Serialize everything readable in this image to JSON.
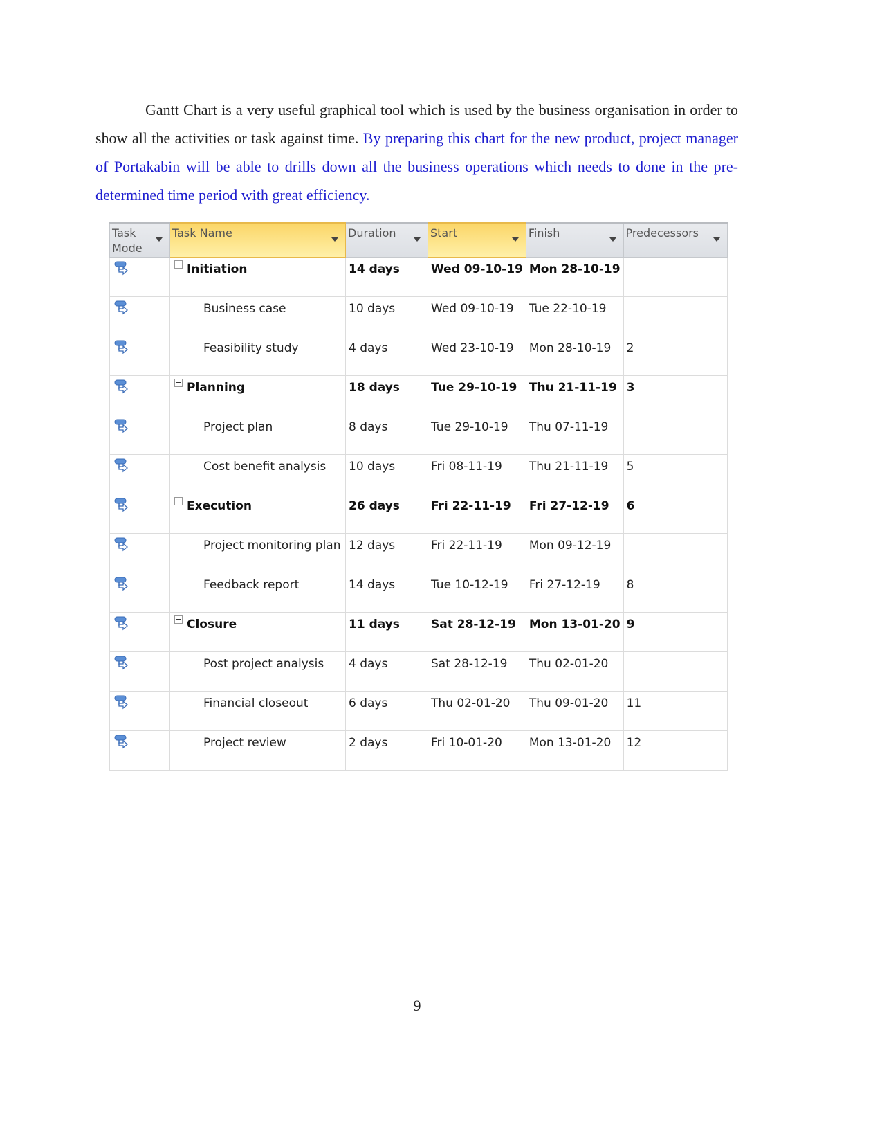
{
  "paragraph": {
    "plain": "Gantt Chart is a very useful graphical tool which is used by the business organisation in order to show all the activities or task against time.",
    "highlighted": "By preparing this chart for the new product, project manager of Portakabin will be able to drills down all the business operations which needs to done in the pre-determined time period with great efficiency.",
    "highlight_color": "#1f1fd0"
  },
  "table": {
    "headers": [
      "Task Mode",
      "Task Name",
      "Duration",
      "Start",
      "Finish",
      "Predecessors"
    ],
    "rows": [
      {
        "name": "Initiation",
        "duration": "14 days",
        "start": "Wed 09-10-19",
        "finish": "Mon 28-10-19",
        "pred": "",
        "summary": true
      },
      {
        "name": "Business case",
        "duration": "10 days",
        "start": "Wed 09-10-19",
        "finish": "Tue 22-10-19",
        "pred": "",
        "summary": false
      },
      {
        "name": "Feasibility study",
        "duration": "4 days",
        "start": "Wed 23-10-19",
        "finish": "Mon 28-10-19",
        "pred": "2",
        "summary": false
      },
      {
        "name": "Planning",
        "duration": "18 days",
        "start": "Tue 29-10-19",
        "finish": "Thu 21-11-19",
        "pred": "3",
        "summary": true
      },
      {
        "name": "Project plan",
        "duration": "8 days",
        "start": "Tue 29-10-19",
        "finish": "Thu 07-11-19",
        "pred": "",
        "summary": false
      },
      {
        "name": "Cost benefit analysis",
        "duration": "10 days",
        "start": "Fri 08-11-19",
        "finish": "Thu 21-11-19",
        "pred": "5",
        "summary": false
      },
      {
        "name": "Execution",
        "duration": "26 days",
        "start": "Fri 22-11-19",
        "finish": "Fri 27-12-19",
        "pred": "6",
        "summary": true
      },
      {
        "name": "Project monitoring plan",
        "duration": "12 days",
        "start": "Fri 22-11-19",
        "finish": "Mon 09-12-19",
        "pred": "",
        "summary": false
      },
      {
        "name": "Feedback report",
        "duration": "14 days",
        "start": "Tue 10-12-19",
        "finish": "Fri 27-12-19",
        "pred": "8",
        "summary": false
      },
      {
        "name": "Closure",
        "duration": "11 days",
        "start": "Sat 28-12-19",
        "finish": "Mon 13-01-20",
        "pred": "9",
        "summary": true
      },
      {
        "name": "Post project analysis",
        "duration": "4 days",
        "start": "Sat 28-12-19",
        "finish": "Thu 02-01-20",
        "pred": "",
        "summary": false
      },
      {
        "name": "Financial closeout",
        "duration": "6 days",
        "start": "Thu 02-01-20",
        "finish": "Thu 09-01-20",
        "pred": "11",
        "summary": false
      },
      {
        "name": "Project review",
        "duration": "2 days",
        "start": "Fri 10-01-20",
        "finish": "Mon 13-01-20",
        "pred": "12",
        "summary": false
      }
    ],
    "task_mode_icon": "auto-scheduled-task-icon",
    "header_highlight_color": "#fbd668"
  },
  "page_number": "9"
}
